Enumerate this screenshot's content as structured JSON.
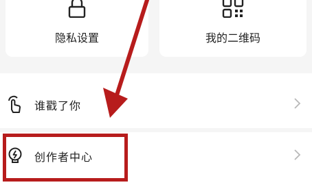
{
  "cards": {
    "privacy_label": "隐私设置",
    "qrcode_label": "我的二维码"
  },
  "menu": {
    "items": [
      {
        "label": "谁戳了你",
        "icon": "tap-hand-icon"
      },
      {
        "label": "创作者中心",
        "icon": "lightbulb-icon"
      }
    ]
  },
  "annotation": {
    "color": "#b71c1c"
  }
}
